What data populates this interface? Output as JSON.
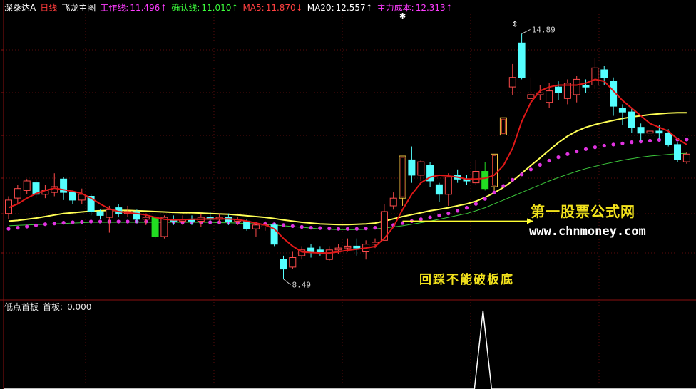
{
  "header": {
    "stock_name": "深桑达A",
    "period": "日线",
    "indicator_name": "飞龙主图",
    "items": [
      {
        "label": "工作线:",
        "value": "11.496",
        "arrow": "↑",
        "color": "#ff3cff"
      },
      {
        "label": "确认线:",
        "value": "11.010",
        "arrow": "↑",
        "color": "#3cff3c"
      },
      {
        "label": "MA5:",
        "value": "11.870",
        "arrow": "↓",
        "color": "#ff4040"
      },
      {
        "label": "MA20:",
        "value": "12.557",
        "arrow": "↑",
        "color": "#ffffff"
      },
      {
        "label": "主力成本:",
        "value": "12.313",
        "arrow": "↑",
        "color": "#ff3cff"
      }
    ]
  },
  "sub_header": {
    "name": "低点首板",
    "label": "首板:",
    "value": "0.000"
  },
  "watermark": {
    "title": "第一股票公式网",
    "url": "www.chnmoney.com"
  },
  "annotation": "回踩不能破板底",
  "colors": {
    "up": "#ff4b4b",
    "down": "#54ffff",
    "limit_up_border": "#f5c542",
    "limit_up_fill": "#c0392b",
    "green_bar": "#22dd22",
    "ma5": "#e01818",
    "ma20": "#ffff55",
    "cost_dots": "#e033e0",
    "long_line": "#3cc83c",
    "grid": "#5a0d0d",
    "axis": "#8a1010"
  },
  "chart_data": {
    "type": "candlestick",
    "price_range": [
      8.0,
      15.4
    ],
    "high_label": "14.89",
    "low_label": "8.49",
    "candles": [
      {
        "o": 10.2,
        "c": 10.55,
        "h": 10.65,
        "l": 10.05
      },
      {
        "o": 10.6,
        "c": 10.85,
        "h": 10.95,
        "l": 10.45
      },
      {
        "o": 10.8,
        "c": 11.05,
        "h": 11.1,
        "l": 10.7
      },
      {
        "o": 11.0,
        "c": 10.7,
        "h": 11.1,
        "l": 10.6
      },
      {
        "o": 10.7,
        "c": 10.8,
        "h": 10.95,
        "l": 10.6
      },
      {
        "o": 10.75,
        "c": 10.9,
        "h": 11.25,
        "l": 10.65
      },
      {
        "o": 11.1,
        "c": 10.75,
        "h": 11.15,
        "l": 10.55
      },
      {
        "o": 10.75,
        "c": 10.55,
        "h": 10.8,
        "l": 10.45
      },
      {
        "o": 10.55,
        "c": 10.7,
        "h": 10.85,
        "l": 10.45
      },
      {
        "o": 10.65,
        "c": 10.25,
        "h": 10.7,
        "l": 10.15
      },
      {
        "o": 10.25,
        "c": 10.15,
        "h": 10.3,
        "l": 10.05
      },
      {
        "o": 10.1,
        "c": 10.3,
        "h": 10.4,
        "l": 9.7
      },
      {
        "o": 10.35,
        "c": 10.2,
        "h": 10.45,
        "l": 10.1
      },
      {
        "o": 10.2,
        "c": 10.25,
        "h": 10.4,
        "l": 10.1
      },
      {
        "o": 10.25,
        "c": 10.05,
        "h": 10.3,
        "l": 9.95
      },
      {
        "o": 10.05,
        "c": 10.1,
        "h": 10.2,
        "l": 9.9
      },
      {
        "o": 10.1,
        "c": 9.6,
        "h": 10.15,
        "l": 9.55,
        "green": true
      },
      {
        "o": 9.6,
        "c": 10.1,
        "h": 10.15,
        "l": 9.55
      },
      {
        "o": 10.05,
        "c": 10.0,
        "h": 10.15,
        "l": 9.9
      },
      {
        "o": 10.0,
        "c": 10.05,
        "h": 10.15,
        "l": 9.9
      },
      {
        "o": 10.05,
        "c": 10.0,
        "h": 10.15,
        "l": 9.9
      },
      {
        "o": 10.0,
        "c": 10.1,
        "h": 10.2,
        "l": 9.85
      },
      {
        "o": 10.1,
        "c": 10.05,
        "h": 10.25,
        "l": 9.95
      },
      {
        "o": 10.05,
        "c": 10.1,
        "h": 10.2,
        "l": 9.95
      },
      {
        "o": 10.1,
        "c": 10.0,
        "h": 10.2,
        "l": 9.9
      },
      {
        "o": 10.0,
        "c": 10.05,
        "h": 10.1,
        "l": 9.9
      },
      {
        "o": 10.0,
        "c": 9.8,
        "h": 10.05,
        "l": 9.75
      },
      {
        "o": 9.8,
        "c": 9.9,
        "h": 9.95,
        "l": 9.6
      },
      {
        "o": 9.85,
        "c": 9.9,
        "h": 10.0,
        "l": 9.75
      },
      {
        "o": 9.9,
        "c": 9.4,
        "h": 9.95,
        "l": 9.35
      },
      {
        "o": 9.0,
        "c": 8.75,
        "h": 9.1,
        "l": 8.49
      },
      {
        "o": 8.8,
        "c": 9.05,
        "h": 9.2,
        "l": 8.75
      },
      {
        "o": 9.1,
        "c": 9.25,
        "h": 9.35,
        "l": 9.0
      },
      {
        "o": 9.3,
        "c": 9.2,
        "h": 9.4,
        "l": 9.05
      },
      {
        "o": 9.25,
        "c": 9.2,
        "h": 9.35,
        "l": 9.1
      },
      {
        "o": 9.0,
        "c": 9.25,
        "h": 9.35,
        "l": 8.95
      },
      {
        "o": 9.25,
        "c": 9.3,
        "h": 9.4,
        "l": 9.15
      },
      {
        "o": 9.3,
        "c": 9.35,
        "h": 9.55,
        "l": 9.2
      },
      {
        "o": 9.35,
        "c": 9.3,
        "h": 9.55,
        "l": 9.1
      },
      {
        "o": 9.2,
        "c": 9.4,
        "h": 9.5,
        "l": 9.0
      },
      {
        "o": 9.4,
        "c": 9.45,
        "h": 9.55,
        "l": 9.3
      },
      {
        "o": 9.5,
        "c": 10.25,
        "h": 10.45,
        "l": 9.5
      },
      {
        "o": 10.4,
        "c": 10.6,
        "h": 10.75,
        "l": 10.3
      },
      {
        "o": 10.6,
        "c": 11.7,
        "h": 11.7,
        "l": 10.4,
        "limit": true
      },
      {
        "o": 11.6,
        "c": 11.2,
        "h": 11.95,
        "l": 11.0
      },
      {
        "o": 11.2,
        "c": 11.55,
        "h": 11.6,
        "l": 11.05
      },
      {
        "o": 11.45,
        "c": 11.05,
        "h": 11.55,
        "l": 10.9
      },
      {
        "o": 10.95,
        "c": 10.7,
        "h": 11.0,
        "l": 10.5
      },
      {
        "o": 10.7,
        "c": 11.15,
        "h": 11.25,
        "l": 10.4
      },
      {
        "o": 11.2,
        "c": 11.1,
        "h": 11.35,
        "l": 11.0
      },
      {
        "o": 11.1,
        "c": 11.05,
        "h": 11.2,
        "l": 10.95
      },
      {
        "o": 11.0,
        "c": 11.3,
        "h": 11.6,
        "l": 10.95
      },
      {
        "o": 11.3,
        "c": 10.85,
        "h": 11.55,
        "l": 10.8,
        "green": true
      },
      {
        "o": 10.9,
        "c": 11.75,
        "h": 11.75,
        "l": 10.8,
        "limit": true
      },
      {
        "o": 12.25,
        "c": 12.7,
        "h": 12.7,
        "l": 12.25,
        "limit": true
      },
      {
        "o": 13.5,
        "c": 13.75,
        "h": 14.1,
        "l": 13.3
      },
      {
        "o": 14.65,
        "c": 13.75,
        "h": 14.89,
        "l": 13.7
      },
      {
        "o": 13.2,
        "c": 13.3,
        "h": 13.75,
        "l": 12.9
      },
      {
        "o": 13.3,
        "c": 13.35,
        "h": 13.55,
        "l": 13.15
      },
      {
        "o": 13.1,
        "c": 13.4,
        "h": 13.6,
        "l": 12.95
      },
      {
        "o": 13.5,
        "c": 13.35,
        "h": 13.65,
        "l": 13.15
      },
      {
        "o": 13.2,
        "c": 13.6,
        "h": 13.7,
        "l": 13.05
      },
      {
        "o": 13.3,
        "c": 13.7,
        "h": 13.8,
        "l": 13.1
      },
      {
        "o": 13.55,
        "c": 13.5,
        "h": 13.7,
        "l": 13.35
      },
      {
        "o": 13.55,
        "c": 14.0,
        "h": 14.25,
        "l": 13.45
      },
      {
        "o": 13.95,
        "c": 13.75,
        "h": 14.05,
        "l": 13.55
      },
      {
        "o": 13.65,
        "c": 13.0,
        "h": 13.75,
        "l": 12.75
      },
      {
        "o": 12.95,
        "c": 12.85,
        "h": 13.05,
        "l": 12.5
      },
      {
        "o": 12.85,
        "c": 12.45,
        "h": 12.95,
        "l": 12.3
      },
      {
        "o": 12.45,
        "c": 12.3,
        "h": 12.55,
        "l": 12.1
      },
      {
        "o": 12.3,
        "c": 12.35,
        "h": 12.55,
        "l": 12.2
      },
      {
        "o": 12.35,
        "c": 12.3,
        "h": 12.5,
        "l": 12.15
      },
      {
        "o": 12.3,
        "c": 12.0,
        "h": 12.4,
        "l": 11.95
      },
      {
        "o": 12.0,
        "c": 11.6,
        "h": 12.05,
        "l": 11.55
      },
      {
        "o": 11.55,
        "c": 11.75,
        "h": 11.8,
        "l": 11.5
      }
    ],
    "ma5": [
      10.35,
      10.45,
      10.6,
      10.72,
      10.8,
      10.86,
      10.82,
      10.78,
      10.72,
      10.6,
      10.45,
      10.32,
      10.25,
      10.22,
      10.2,
      10.16,
      10.1,
      10.05,
      10.03,
      10.04,
      10.05,
      10.05,
      10.06,
      10.06,
      10.06,
      10.04,
      10.0,
      9.95,
      9.9,
      9.8,
      9.55,
      9.35,
      9.2,
      9.18,
      9.17,
      9.17,
      9.2,
      9.24,
      9.27,
      9.3,
      9.34,
      9.55,
      9.85,
      10.3,
      10.7,
      11.0,
      11.15,
      11.2,
      11.18,
      11.15,
      11.1,
      11.1,
      11.12,
      11.2,
      11.45,
      11.9,
      12.6,
      13.1,
      13.4,
      13.5,
      13.55,
      13.55,
      13.55,
      13.6,
      13.7,
      13.65,
      13.4,
      13.15,
      12.95,
      12.75,
      12.55,
      12.45,
      12.35,
      12.15,
      12.0
    ],
    "ma20": [
      10.0,
      10.02,
      10.05,
      10.08,
      10.12,
      10.16,
      10.2,
      10.22,
      10.24,
      10.26,
      10.27,
      10.28,
      10.28,
      10.28,
      10.27,
      10.26,
      10.25,
      10.24,
      10.23,
      10.22,
      10.22,
      10.21,
      10.2,
      10.19,
      10.18,
      10.16,
      10.14,
      10.12,
      10.1,
      10.07,
      10.03,
      10.0,
      9.97,
      9.95,
      9.93,
      9.92,
      9.91,
      9.91,
      9.92,
      9.93,
      9.95,
      10.0,
      10.06,
      10.12,
      10.17,
      10.22,
      10.27,
      10.31,
      10.35,
      10.4,
      10.45,
      10.52,
      10.62,
      10.74,
      10.88,
      11.05,
      11.25,
      11.45,
      11.65,
      11.85,
      12.05,
      12.22,
      12.35,
      12.45,
      12.52,
      12.58,
      12.63,
      12.68,
      12.72,
      12.75,
      12.78,
      12.8,
      12.82,
      12.83,
      12.83
    ],
    "cost": [
      9.8,
      9.83,
      9.86,
      9.89,
      9.92,
      9.94,
      9.96,
      9.97,
      9.98,
      9.99,
      9.99,
      9.99,
      9.99,
      9.99,
      9.99,
      9.99,
      9.98,
      9.98,
      9.98,
      9.97,
      9.97,
      9.97,
      9.97,
      9.97,
      9.96,
      9.96,
      9.95,
      9.94,
      9.93,
      9.92,
      9.9,
      9.87,
      9.85,
      9.83,
      9.82,
      9.81,
      9.8,
      9.8,
      9.8,
      9.81,
      9.83,
      9.86,
      9.9,
      9.95,
      10.0,
      10.05,
      10.1,
      10.15,
      10.2,
      10.27,
      10.35,
      10.45,
      10.58,
      10.75,
      10.92,
      11.08,
      11.22,
      11.35,
      11.47,
      11.58,
      11.67,
      11.75,
      11.82,
      11.88,
      11.93,
      11.97,
      12.0,
      12.03,
      12.06,
      12.08,
      12.1,
      12.12,
      12.13,
      12.13,
      12.13
    ],
    "long": [
      9.88,
      9.89,
      9.9,
      9.91,
      9.92,
      9.93,
      9.94,
      9.95,
      9.96,
      9.97,
      9.97,
      9.97,
      9.97,
      9.97,
      9.97,
      9.97,
      9.97,
      9.97,
      9.97,
      9.97,
      9.97,
      9.97,
      9.97,
      9.96,
      9.96,
      9.95,
      9.94,
      9.93,
      9.92,
      9.9,
      9.88,
      9.86,
      9.84,
      9.82,
      9.8,
      9.79,
      9.78,
      9.78,
      9.78,
      9.79,
      9.8,
      9.82,
      9.85,
      9.88,
      9.92,
      9.96,
      10.0,
      10.05,
      10.1,
      10.15,
      10.2,
      10.27,
      10.35,
      10.45,
      10.55,
      10.65,
      10.75,
      10.85,
      10.95,
      11.05,
      11.14,
      11.22,
      11.3,
      11.37,
      11.43,
      11.49,
      11.54,
      11.59,
      11.63,
      11.67,
      11.7,
      11.72,
      11.74,
      11.76,
      11.77
    ],
    "sub_indicator": {
      "name": "首板",
      "peak_index": 51,
      "peak_value": 1,
      "current": 0.0
    }
  }
}
